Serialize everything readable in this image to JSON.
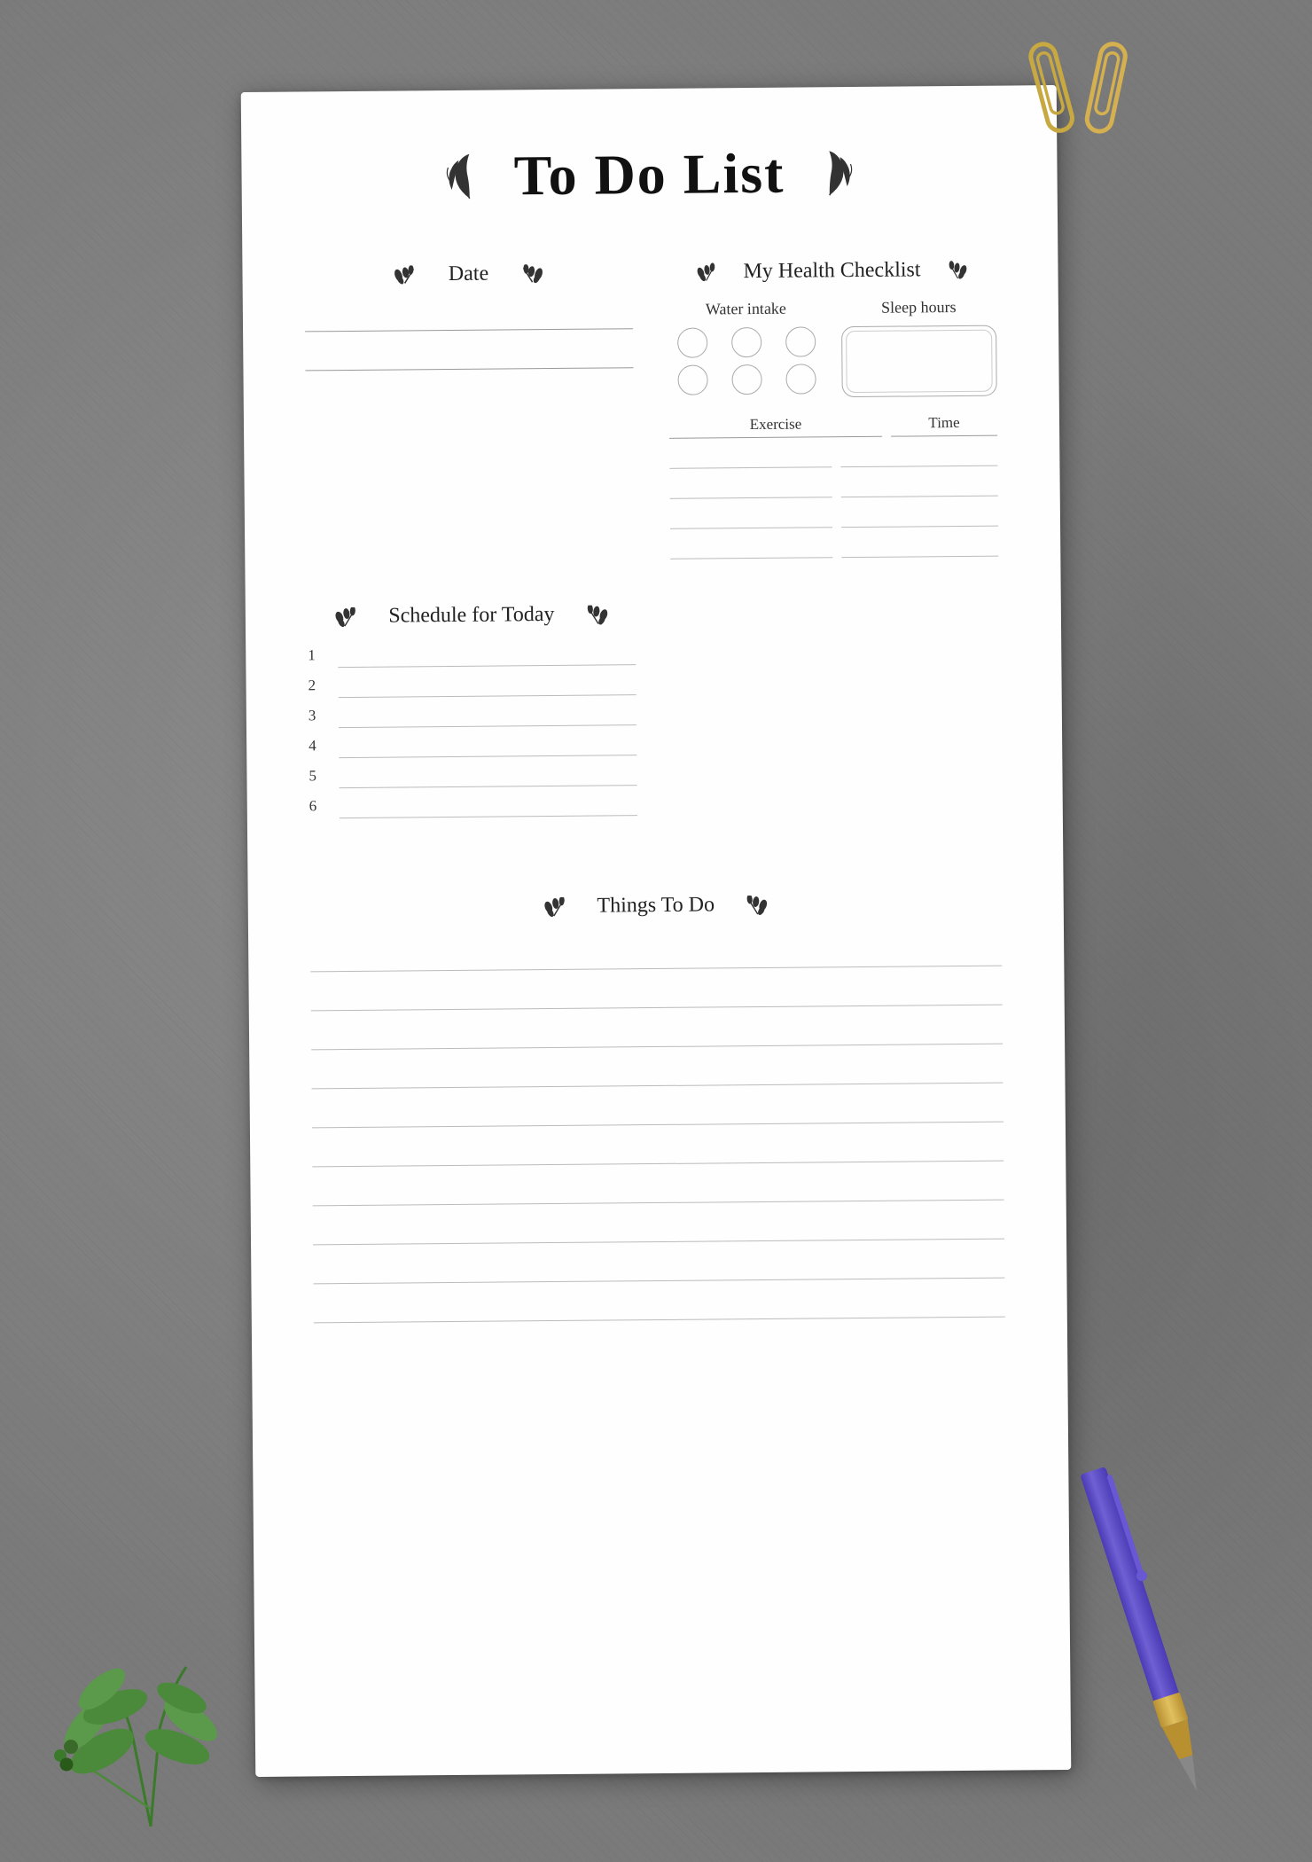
{
  "title": "To Do List",
  "sections": {
    "date": {
      "label": "Date",
      "fields": [
        "",
        ""
      ]
    },
    "healthChecklist": {
      "label": "My Health Checklist",
      "waterIntake": {
        "label": "Water intake",
        "circles": 6
      },
      "sleepHours": {
        "label": "Sleep hours"
      },
      "exercise": {
        "label": "Exercise",
        "timeLabel": "Time",
        "rows": [
          "",
          "",
          "",
          ""
        ]
      }
    },
    "schedule": {
      "label": "Schedule for Today",
      "items": [
        {
          "number": "1"
        },
        {
          "number": "2"
        },
        {
          "number": "3"
        },
        {
          "number": "4"
        },
        {
          "number": "5"
        },
        {
          "number": "6"
        }
      ]
    },
    "thingsToDo": {
      "label": "Things To Do",
      "lines": 10
    }
  },
  "decorations": {
    "leafLeft": "❧",
    "leafRight": "❧",
    "wheatLeft": "⸙",
    "wheatRight": "⸙"
  }
}
